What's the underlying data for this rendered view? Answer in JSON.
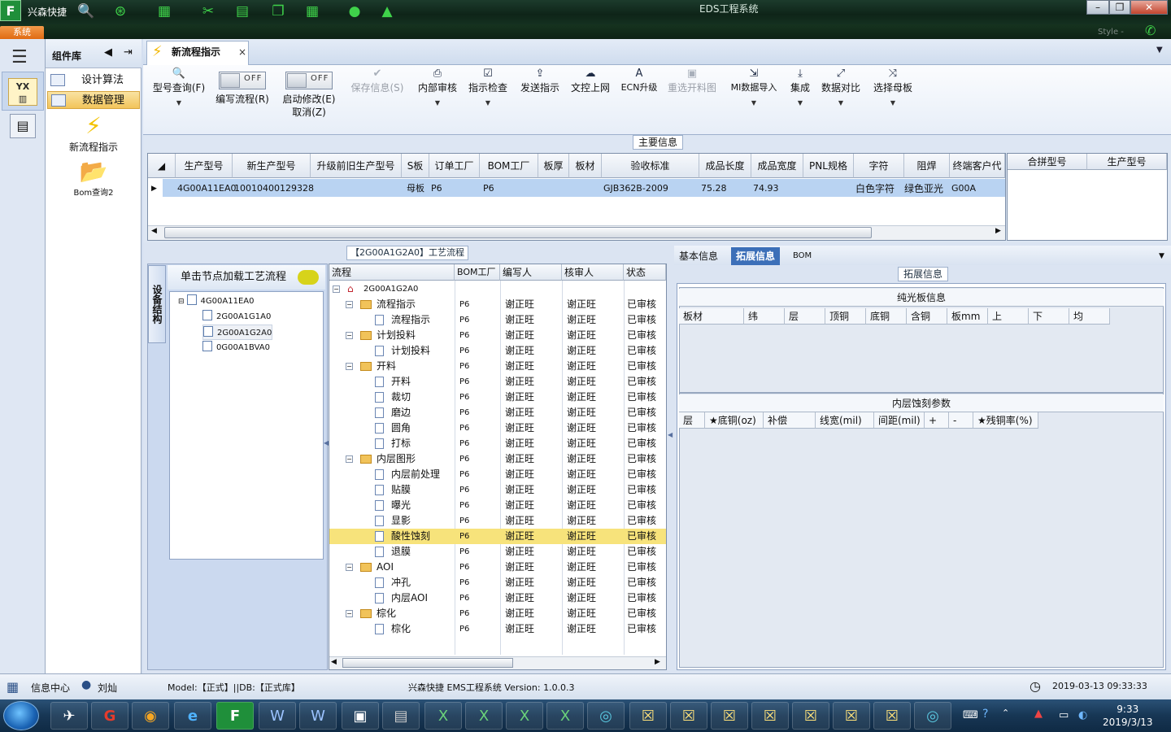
{
  "app": {
    "name": "兴森快捷",
    "logo_letter": "F",
    "window_title": "EDS工程系统",
    "system_tab": "系统",
    "style_label": "Style -"
  },
  "component_panel": {
    "title": "组件库",
    "items": [
      "设计算法",
      "数据管理"
    ],
    "big_items": [
      "新流程指示",
      "Bom查询2"
    ]
  },
  "tab": {
    "label": "新流程指示",
    "close": "×"
  },
  "ribbon": {
    "buttons": [
      {
        "label": "型号查询(F)"
      },
      {
        "label": "编写流程(R)",
        "toggle": "OFF"
      },
      {
        "label": "启动修改(E)",
        "label2": "取消(Z)",
        "toggle": "OFF"
      },
      {
        "label": "保存信息(S)"
      },
      {
        "label": "内部审核"
      },
      {
        "label": "指示检查"
      },
      {
        "label": "发送指示"
      },
      {
        "label": "文控上网"
      },
      {
        "label": "ECN升级"
      },
      {
        "label": "重选开料图"
      },
      {
        "label": "MI数据导入"
      },
      {
        "label": "集成"
      },
      {
        "label": "数据对比"
      },
      {
        "label": "选择母板"
      }
    ]
  },
  "main_info": {
    "label": "主要信息",
    "columns": [
      "生产型号",
      "新生产型号",
      "升级前旧生产型号",
      "S板",
      "订单工厂",
      "BOM工厂",
      "板厚",
      "板材",
      "验收标准",
      "成品长度",
      "成品宽度",
      "PNL规格",
      "字符",
      "阻焊",
      "终端客户代"
    ],
    "row": {
      "c0": "4G00A11EA0",
      "c1": "10010400129328",
      "c2": "",
      "c3": "母板",
      "c4": "P6",
      "c5": "P6",
      "c6": "",
      "c7": "",
      "c8": "GJB362B-2009",
      "c9": "75.28",
      "c10": "74.93",
      "c11": "",
      "c12": "白色字符",
      "c13": "绿色亚光",
      "c14": "G00A"
    },
    "side_columns": [
      "合拼型号",
      "生产型号"
    ]
  },
  "flow": {
    "label": "【2G00A1G2A0】工艺流程",
    "side_tab": "设备结构",
    "load_hint": "单击节点加载工艺流程",
    "tree": [
      "4G00A11EA0",
      "2G00A1G1A0",
      "2G00A1G2A0",
      "0G00A1BVA0"
    ],
    "columns": [
      "流程",
      "BOM工厂",
      "编写人",
      "核审人",
      "状态"
    ],
    "root": "2G00A1G2A0",
    "rows": [
      {
        "name": "流程指示",
        "level": 1,
        "folder": true,
        "f": "P6",
        "w": "谢正旺",
        "r": "谢正旺",
        "s": "已审核"
      },
      {
        "name": "流程指示",
        "level": 2,
        "folder": false,
        "f": "P6",
        "w": "谢正旺",
        "r": "谢正旺",
        "s": "已审核"
      },
      {
        "name": "计划投料",
        "level": 1,
        "folder": true,
        "f": "P6",
        "w": "谢正旺",
        "r": "谢正旺",
        "s": "已审核"
      },
      {
        "name": "计划投料",
        "level": 2,
        "folder": false,
        "f": "P6",
        "w": "谢正旺",
        "r": "谢正旺",
        "s": "已审核"
      },
      {
        "name": "开料",
        "level": 1,
        "folder": true,
        "f": "P6",
        "w": "谢正旺",
        "r": "谢正旺",
        "s": "已审核"
      },
      {
        "name": "开料",
        "level": 2,
        "folder": false,
        "f": "P6",
        "w": "谢正旺",
        "r": "谢正旺",
        "s": "已审核"
      },
      {
        "name": "裁切",
        "level": 2,
        "folder": false,
        "f": "P6",
        "w": "谢正旺",
        "r": "谢正旺",
        "s": "已审核"
      },
      {
        "name": "磨边",
        "level": 2,
        "folder": false,
        "f": "P6",
        "w": "谢正旺",
        "r": "谢正旺",
        "s": "已审核"
      },
      {
        "name": "圆角",
        "level": 2,
        "folder": false,
        "f": "P6",
        "w": "谢正旺",
        "r": "谢正旺",
        "s": "已审核"
      },
      {
        "name": "打标",
        "level": 2,
        "folder": false,
        "f": "P6",
        "w": "谢正旺",
        "r": "谢正旺",
        "s": "已审核"
      },
      {
        "name": "内层图形",
        "level": 1,
        "folder": true,
        "f": "P6",
        "w": "谢正旺",
        "r": "谢正旺",
        "s": "已审核"
      },
      {
        "name": "内层前处理",
        "level": 2,
        "folder": false,
        "f": "P6",
        "w": "谢正旺",
        "r": "谢正旺",
        "s": "已审核"
      },
      {
        "name": "贴膜",
        "level": 2,
        "folder": false,
        "f": "P6",
        "w": "谢正旺",
        "r": "谢正旺",
        "s": "已审核"
      },
      {
        "name": "曝光",
        "level": 2,
        "folder": false,
        "f": "P6",
        "w": "谢正旺",
        "r": "谢正旺",
        "s": "已审核"
      },
      {
        "name": "显影",
        "level": 2,
        "folder": false,
        "f": "P6",
        "w": "谢正旺",
        "r": "谢正旺",
        "s": "已审核"
      },
      {
        "name": "酸性蚀刻",
        "level": 2,
        "folder": false,
        "f": "P6",
        "w": "谢正旺",
        "r": "谢正旺",
        "s": "已审核",
        "hl": true
      },
      {
        "name": "退膜",
        "level": 2,
        "folder": false,
        "f": "P6",
        "w": "谢正旺",
        "r": "谢正旺",
        "s": "已审核"
      },
      {
        "name": "AOI",
        "level": 1,
        "folder": true,
        "f": "P6",
        "w": "谢正旺",
        "r": "谢正旺",
        "s": "已审核"
      },
      {
        "name": "冲孔",
        "level": 2,
        "folder": false,
        "f": "P6",
        "w": "谢正旺",
        "r": "谢正旺",
        "s": "已审核"
      },
      {
        "name": "内层AOI",
        "level": 2,
        "folder": false,
        "f": "P6",
        "w": "谢正旺",
        "r": "谢正旺",
        "s": "已审核"
      },
      {
        "name": "棕化",
        "level": 1,
        "folder": true,
        "f": "P6",
        "w": "谢正旺",
        "r": "谢正旺",
        "s": "已审核"
      },
      {
        "name": "棕化",
        "level": 2,
        "folder": false,
        "f": "P6",
        "w": "谢正旺",
        "r": "谢正旺",
        "s": "已审核"
      }
    ]
  },
  "right": {
    "tabs": [
      "基本信息",
      "拓展信息",
      "BOM"
    ],
    "label": "拓展信息",
    "sec1_title": "纯光板信息",
    "sec1_cols": [
      "板材",
      "纬",
      "层",
      "顶铜",
      "底铜",
      "含铜",
      "板mm",
      "上",
      "下",
      "均"
    ],
    "sec2_title": "内层蚀刻参数",
    "sec2_cols": [
      "层",
      "★底铜(oz)",
      "补偿",
      "线宽(mil)",
      "间距(mil)",
      "+",
      "-",
      "★残铜率(%)"
    ]
  },
  "status": {
    "info": "信息中心",
    "user": "刘灿",
    "model": "Model:【正式】||DB:【正式库】",
    "version": "兴森快捷 EMS工程系统 Version: 1.0.0.3",
    "datetime": "2019-03-13 09:33:33"
  },
  "taskbar": {
    "time": "9:33",
    "date": "2019/3/13"
  },
  "colors": {
    "accent": "#3c6fb8",
    "selection": "#b9d3f2",
    "highlight": "#f7e37b"
  }
}
